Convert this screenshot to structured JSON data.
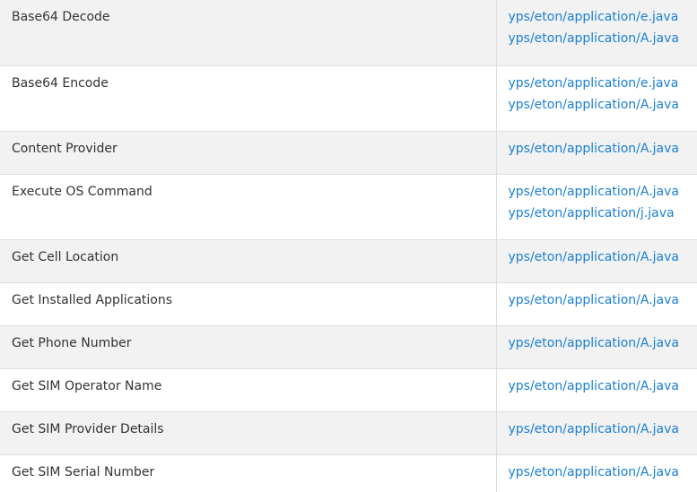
{
  "rows": [
    {
      "api": "Base64 Decode",
      "files": [
        "yps/eton/application/e.java",
        "yps/eton/application/A.java"
      ]
    },
    {
      "api": "Base64 Encode",
      "files": [
        "yps/eton/application/e.java",
        "yps/eton/application/A.java"
      ]
    },
    {
      "api": "Content Provider",
      "files": [
        "yps/eton/application/A.java"
      ]
    },
    {
      "api": "Execute OS Command",
      "files": [
        "yps/eton/application/A.java",
        "yps/eton/application/j.java"
      ]
    },
    {
      "api": "Get Cell Location",
      "files": [
        "yps/eton/application/A.java"
      ]
    },
    {
      "api": "Get Installed Applications",
      "files": [
        "yps/eton/application/A.java"
      ]
    },
    {
      "api": "Get Phone Number",
      "files": [
        "yps/eton/application/A.java"
      ]
    },
    {
      "api": "Get SIM Operator Name",
      "files": [
        "yps/eton/application/A.java"
      ]
    },
    {
      "api": "Get SIM Provider Details",
      "files": [
        "yps/eton/application/A.java"
      ]
    },
    {
      "api": "Get SIM Serial Number",
      "files": [
        "yps/eton/application/A.java"
      ]
    }
  ],
  "colors": {
    "row_alt": "#f2f2f2",
    "link": "#1a7fd8",
    "text": "#333333",
    "border": "#dddddd"
  }
}
